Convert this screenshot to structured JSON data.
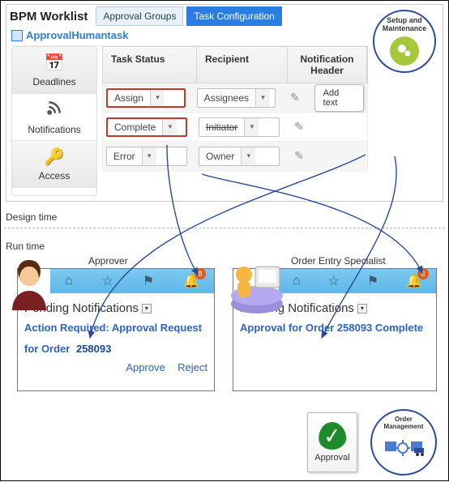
{
  "header": {
    "worklist_label": "BPM Worklist",
    "tabs": {
      "approval_groups": "Approval Groups",
      "task_config": "Task Configuration"
    },
    "task_name": "ApprovalHumantask",
    "setup_maintenance": "Setup and\nMaintenance"
  },
  "sidebar": {
    "deadlines": "Deadlines",
    "notifications": "Notifications",
    "access": "Access"
  },
  "grid": {
    "headers": {
      "task_status": "Task Status",
      "recipient": "Recipient",
      "notif_header": "Notification Header"
    },
    "rows": [
      {
        "status": "Assign",
        "recipient": "Assignees",
        "addtext_label": "Add text"
      },
      {
        "status": "Complete",
        "recipient": "Initiator"
      },
      {
        "status": "Error",
        "recipient": "Owner"
      }
    ]
  },
  "sections": {
    "design_time": "Design time",
    "run_time": "Run time"
  },
  "roles": {
    "approver": "Approver",
    "entry_specialist": "Order Entry Specialist"
  },
  "runtime": {
    "pending_label": "Pending Notifications",
    "badge_count": "8",
    "approver_notif": {
      "line1": "Action Required: Approval Request",
      "line2_prefix": "for Order",
      "order_id": "258093",
      "approve": "Approve",
      "reject": "Reject"
    },
    "specialist_notif": {
      "text": "Approval for Order 258093 Complete"
    }
  },
  "footer": {
    "approval": "Approval",
    "order_mgmt": "Order\nManagement"
  }
}
